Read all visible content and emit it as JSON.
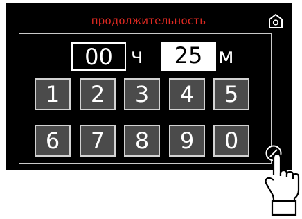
{
  "screen": {
    "title": "продолжительность",
    "title_color": "#e02a22",
    "background": "#000000"
  },
  "timer": {
    "hours_value": "00",
    "hours_unit": "ч",
    "minutes_value": "25",
    "minutes_unit": "м",
    "selected_field": "minutes"
  },
  "keypad": {
    "keys": [
      "1",
      "2",
      "3",
      "4",
      "5",
      "6",
      "7",
      "8",
      "9",
      "0"
    ]
  },
  "icons": {
    "home": "home-icon",
    "edit": "edit-icon",
    "hand": "pointing-hand-icon"
  }
}
